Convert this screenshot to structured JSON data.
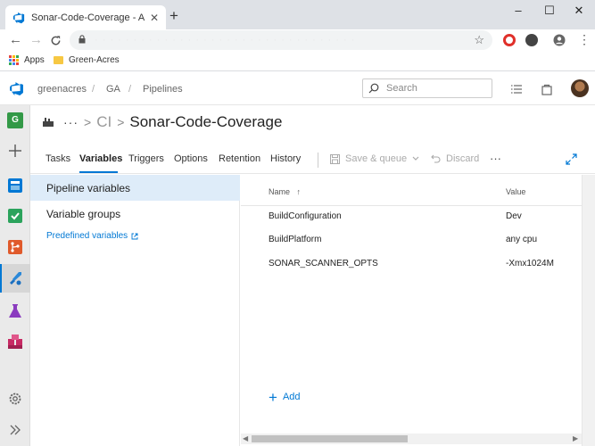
{
  "browser": {
    "tab_title": "Sonar-Code-Coverage - Azure D",
    "tab_close": "✕",
    "new_tab": "+",
    "window_controls": {
      "minimize": "–",
      "maximize": "☐",
      "close": "✕"
    },
    "nav": {
      "back": "←",
      "forward": "→",
      "reload": "C"
    },
    "url": "· · · · · · · · · · · · · · · · · · · · · · · · · · · · · · · · · ·",
    "star": "☆",
    "menu": "⋮",
    "bookmarks": [
      {
        "label": "Apps",
        "icon": "apps-grid-icon"
      },
      {
        "label": "Green-Acres",
        "icon": "folder-icon"
      }
    ]
  },
  "ado": {
    "breadcrumb": [
      "greenacres",
      "GA",
      "Pipelines"
    ],
    "breadcrumb_sep": "/",
    "search_placeholder": "Search",
    "rail_project_letter": "G",
    "brand_color": "#0078d4"
  },
  "pipeline": {
    "more": "···",
    "chevron": ">",
    "ci_label": "CI",
    "title": "Sonar-Code-Coverage"
  },
  "tabs": [
    {
      "label": "Tasks",
      "active": false
    },
    {
      "label": "Variables",
      "active": true
    },
    {
      "label": "Triggers",
      "active": false
    },
    {
      "label": "Options",
      "active": false
    },
    {
      "label": "Retention",
      "active": false
    },
    {
      "label": "History",
      "active": false
    }
  ],
  "toolbar": {
    "save_queue": "Save & queue",
    "discard": "Discard",
    "more": "···"
  },
  "left_panel": {
    "items": [
      {
        "label": "Pipeline variables",
        "selected": true
      },
      {
        "label": "Variable groups",
        "selected": false
      }
    ],
    "link": "Predefined variables"
  },
  "table": {
    "columns": {
      "name": "Name",
      "sort_indicator": "↑",
      "value": "Value"
    },
    "rows": [
      {
        "name": "BuildConfiguration",
        "value": "Dev"
      },
      {
        "name": "BuildPlatform",
        "value": "any cpu"
      },
      {
        "name": "SONAR_SCANNER_OPTS",
        "value": "-Xmx1024M"
      }
    ],
    "add_label": "Add",
    "add_plus": "+"
  }
}
